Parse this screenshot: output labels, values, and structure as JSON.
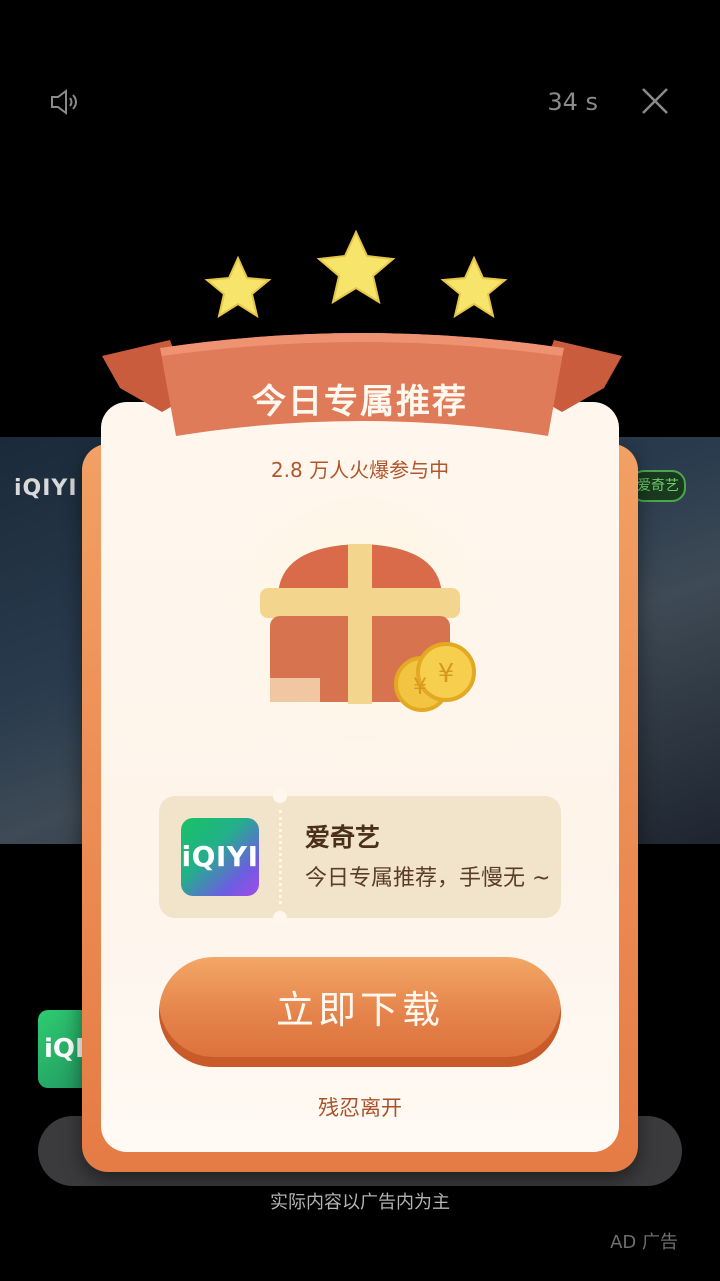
{
  "topbar": {
    "countdown": "34 s"
  },
  "background": {
    "logo_text": "iQIYI 爱",
    "badge_text": "爱奇艺",
    "app_icon_text": "iQI",
    "disclaimer": "实际内容以广告内为主",
    "ad_label": "AD 广告"
  },
  "modal": {
    "title": "今日专属推荐",
    "participants": "2.8 万人火爆参与中",
    "app": {
      "icon_text": "iQIYI",
      "name": "爱奇艺",
      "description": "今日专属推荐，手慢无 ~"
    },
    "download_label": "立即下载",
    "leave_label": "残忍离开"
  },
  "colors": {
    "accent_orange": "#e4814a",
    "ribbon_red": "#d9694a",
    "star_yellow": "#f7e46a",
    "modal_bg": "#fff7ee"
  }
}
